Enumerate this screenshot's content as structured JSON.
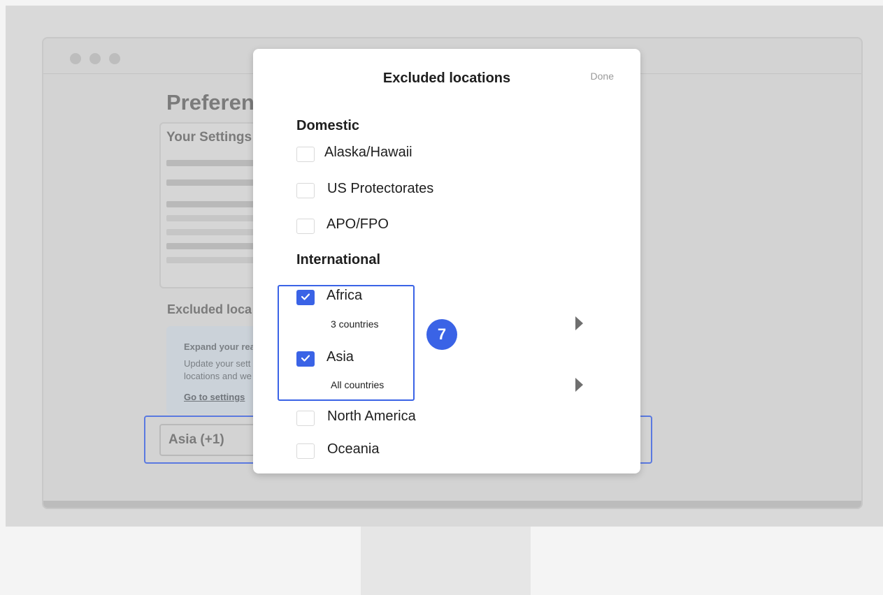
{
  "background": {
    "page_title": "Preferen",
    "settings_card_title": "Your Settings",
    "excluded_heading": "Excluded loca",
    "info": {
      "title": "Expand your rea",
      "line1": "Update your sett",
      "line2": "locations and we",
      "link": "Go to settings"
    },
    "selected_chip": "Asia (+1)"
  },
  "modal": {
    "title": "Excluded locations",
    "done_label": "Done",
    "domestic": {
      "heading": "Domestic",
      "items": [
        {
          "label": "Alaska/Hawaii",
          "checked": false
        },
        {
          "label": "US Protectorates",
          "checked": false
        },
        {
          "label": "APO/FPO",
          "checked": false
        }
      ]
    },
    "international": {
      "heading": "International",
      "items": [
        {
          "label": "Africa",
          "checked": true,
          "sub": "3 countries"
        },
        {
          "label": "Asia",
          "checked": true,
          "sub": "All countries"
        },
        {
          "label": "North America",
          "checked": false
        },
        {
          "label": "Oceania",
          "checked": false
        }
      ]
    }
  },
  "step_badge": "7",
  "colors": {
    "accent": "#3a63e6",
    "chip_outline": "#5a79e0",
    "muted_text": "#7b7b7b"
  }
}
